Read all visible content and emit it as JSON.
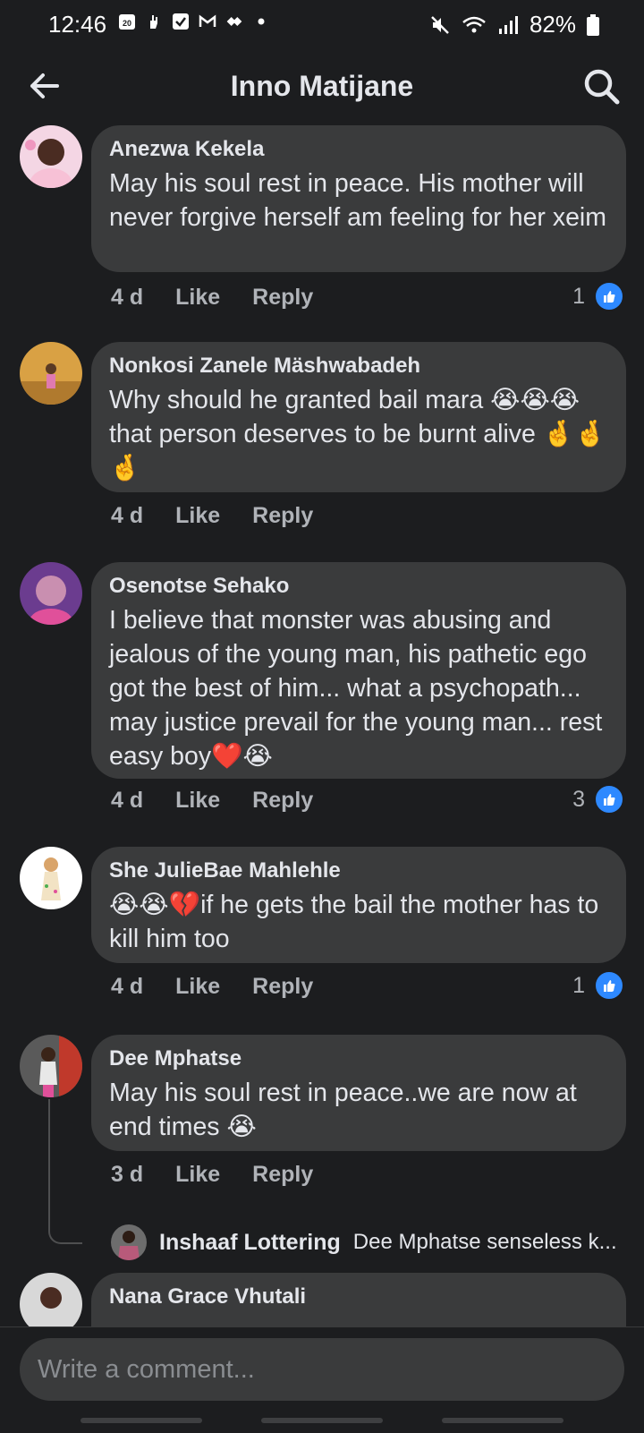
{
  "status_bar": {
    "time": "12:46",
    "battery": "82%",
    "left_icons": [
      "calendar-icon",
      "hand-icon",
      "checkbox-icon",
      "gmail-icon",
      "diamond-icon",
      "dot-icon"
    ],
    "right_icons": [
      "mute-icon",
      "wifi-icon",
      "signal-icon",
      "battery-icon"
    ]
  },
  "header": {
    "title": "Inno Matijane",
    "back_icon": "arrow-left-icon",
    "search_icon": "search-icon"
  },
  "comments": [
    {
      "name": "Anezwa Kekela",
      "text": "May his soul rest in peace. His mother will never forgive herself am feeling for her xeim",
      "time": "4 d",
      "like": "Like",
      "reply": "Reply",
      "reaction_count": "1"
    },
    {
      "name": "Nonkosi Zanele Mäshwabadeh",
      "text": "Why should he granted bail mara 😭😭😭 that person deserves to be burnt alive 🤞🤞🤞",
      "time": "4 d",
      "like": "Like",
      "reply": "Reply"
    },
    {
      "name": "Osenotse Sehako",
      "text": "I believe that monster was abusing and jealous of the young man, his pathetic ego got the best of him... what a psychopath... may justice prevail for the young man... rest easy boy❤️😭",
      "time": "4 d",
      "like": "Like",
      "reply": "Reply",
      "reaction_count": "3"
    },
    {
      "name": "She JulieBae Mahlehle",
      "text": "😭😭💔if he gets the bail the mother has to kill him too",
      "time": "4 d",
      "like": "Like",
      "reply": "Reply",
      "reaction_count": "1"
    },
    {
      "name": "Dee Mphatse",
      "text": "May his soul rest in peace..we are now at end times 😭",
      "time": "3 d",
      "like": "Like",
      "reply": "Reply",
      "reply_preview": {
        "name": "Inshaaf Lottering",
        "text": "Dee Mphatse senseless k..."
      }
    },
    {
      "name": "Nana Grace Vhutali"
    }
  ],
  "composer": {
    "placeholder": "Write a comment..."
  },
  "colors": {
    "background": "#1c1d1f",
    "bubble": "#3a3b3c",
    "like_blue": "#2e89ff",
    "muted_text": "#b0b3b8"
  }
}
